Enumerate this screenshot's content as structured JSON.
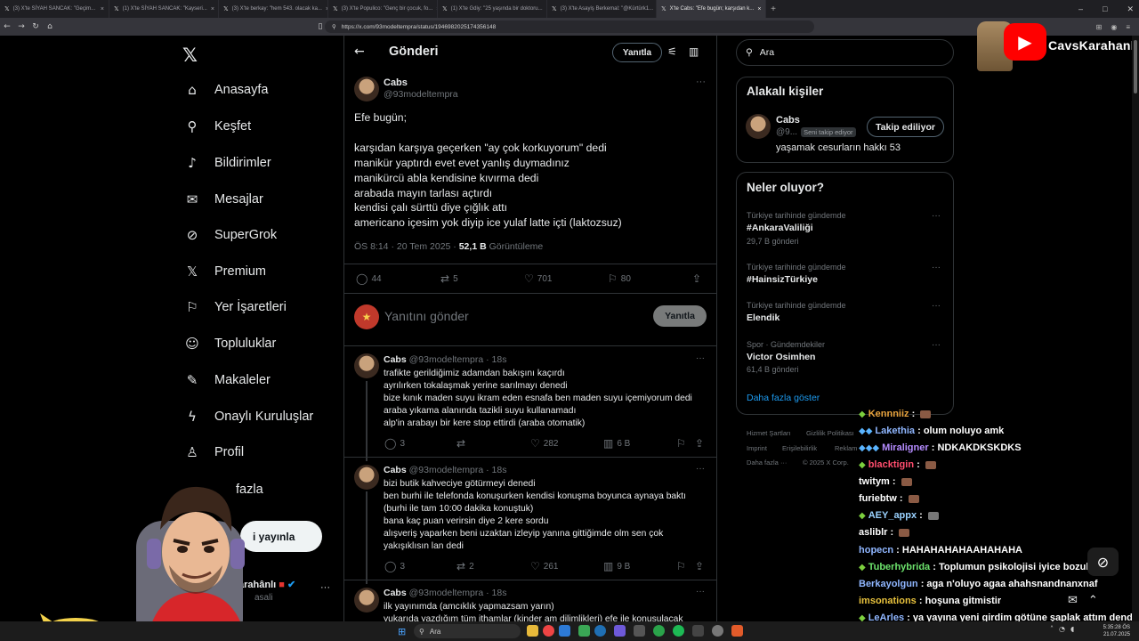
{
  "browser": {
    "tabs": [
      {
        "title": "(3) X'te SİYAH SANCAK: \"Geçim...",
        "active": false
      },
      {
        "title": "(1) X'te SİYAH SANCAK: \"Kayseri...",
        "active": false
      },
      {
        "title": "(3) X'te berkay: \"hem 543. olacak ka...",
        "active": false
      },
      {
        "title": "(3) X'te Populico: \"Genç bir çocuk, fo...",
        "active": false
      },
      {
        "title": "(1) X'te Gdiy: \"25 yaşında bir doktoru...",
        "active": false
      },
      {
        "title": "(3) X'te Asayiş Berkemal: \"@Kürtürk1...",
        "active": false
      },
      {
        "title": "X'te Cabs: \"Efe bugün; karşıdan k...",
        "active": true
      }
    ],
    "url": "https://x.com/93modeltempra/status/1946982025174356148"
  },
  "nav": {
    "items": [
      {
        "label": "Anasayfa",
        "icon": "home-icon"
      },
      {
        "label": "Keşfet",
        "icon": "search-icon"
      },
      {
        "label": "Bildirimler",
        "icon": "bell-icon"
      },
      {
        "label": "Mesajlar",
        "icon": "mail-icon"
      },
      {
        "label": "SuperGrok",
        "icon": "grok-icon"
      },
      {
        "label": "Premium",
        "icon": "x-icon"
      },
      {
        "label": "Yer İşaretleri",
        "icon": "bookmark-icon"
      },
      {
        "label": "Topluluklar",
        "icon": "people-icon"
      },
      {
        "label": "Makaleler",
        "icon": "article-icon"
      },
      {
        "label": "Onaylı Kuruluşlar",
        "icon": "lightning-icon"
      },
      {
        "label": "Profil",
        "icon": "person-icon"
      },
      {
        "label": "fazla",
        "icon": "more-icon"
      }
    ],
    "post_button": "i yayınla",
    "account_name": "arahânlı",
    "account_handle": "asali"
  },
  "header": {
    "title": "Gönderi",
    "reply_button": "Yanıtla"
  },
  "post": {
    "author": "Cabs",
    "handle": "@93modeltempra",
    "text": "Efe bugün;\n\nkarşıdan karşıya geçerken \"ay çok korkuyorum\" dedi\nmanikür yaptırdı evet evet yanlış duymadınız\nmanikürcü abla kendisine kıvırma dedi\narabada mayın tarlası açtırdı\nkendisi çalı sürttü diye çığlık attı\namericano içesim yok diyip ice yulaf latte içti (laktozsuz)",
    "time": "ÖS 8:14 · 20 Tem 2025 · ",
    "views": "52,1 B",
    "views_label": " Görüntüleme",
    "replies": "44",
    "reposts": "5",
    "likes": "701",
    "bookmarks": "80"
  },
  "composer": {
    "placeholder": "Yanıtını gönder",
    "button": "Yanıtla"
  },
  "replies": [
    {
      "author": "Cabs",
      "meta": " @93modeltempra · 18s",
      "text": "trafikte gerildiğimiz adamdan bakışını kaçırdı\nayrılırken tokalaşmak yerine sarılmayı denedi\nbize kınık maden suyu ikram eden esnafa ben maden suyu içemiyorum dedi\naraba yıkama alanında tazikli suyu kullanamadı\nalp'in arabayı bir kere stop ettirdi (araba otomatik)",
      "replies": "3",
      "reposts": "",
      "likes": "282",
      "views": "6 B"
    },
    {
      "author": "Cabs",
      "meta": " @93modeltempra · 18s",
      "text": "bizi butik kahveciye götürmeyi denedi\nben burhi ile telefonda konuşurken kendisi konuşma boyunca aynaya baktı\n(burhi ile tam 10:00 dakika konuştuk)\nbana kaç puan verirsin diye 2 kere sordu\nalışveriş yaparken beni uzaktan izleyip yanına gittiğimde olm sen çok\nyakışıklısın lan dedi",
      "replies": "3",
      "reposts": "2",
      "likes": "261",
      "views": "9 B"
    },
    {
      "author": "Cabs",
      "meta": " @93modeltempra · 18s",
      "text": "ilk yayınımda (amcıklık yapmazsam yarın)\nyukarıda yazdığım tüm ithamlar (kinder am dilimlikleri) efe ile konuşulacak",
      "replies": "",
      "reposts": "",
      "likes": "",
      "views": ""
    }
  ],
  "right": {
    "search_placeholder": "Ara",
    "who": {
      "title": "Alakalı kişiler",
      "name": "Cabs",
      "handle": "@9...",
      "badge": "Seni takip ediyor",
      "bio": "yaşamak cesurların hakkı 53",
      "button": "Takip ediliyor"
    },
    "trends": {
      "title": "Neler oluyor?",
      "items": [
        {
          "context": "Türkiye tarihinde gündemde",
          "name": "#AnkaraValiliği",
          "count": "29,7 B gönderi"
        },
        {
          "context": "Türkiye tarihinde gündemde",
          "name": "#HainsizTürkiye",
          "count": ""
        },
        {
          "context": "Türkiye tarihinde gündemde",
          "name": "Elendik",
          "count": ""
        },
        {
          "context": "Spor · Gündemdekiler",
          "name": "Victor Osimhen",
          "count": "61,4 B gönderi"
        }
      ],
      "show_more": "Daha fazla göster"
    },
    "footer": [
      "Hizmet Şartları",
      "Gizlilik Politikası",
      "Imprint",
      "Erişilebilirlik",
      "Reklam",
      "Daha fazla ···",
      "© 2025 X Corp."
    ]
  },
  "stream": {
    "channel": "CavsKarahanli",
    "chat": [
      {
        "user": "Kennniiz",
        "color": "#e8a33d",
        "msg": ""
      },
      {
        "user": "Lakethia",
        "color": "#8fb6ff",
        "msg": "olum noluyo amk"
      },
      {
        "user": "Miraligner",
        "color": "#b58cff",
        "msg": "NDKAKDKSKDKS"
      },
      {
        "user": "blacktigin",
        "color": "#ff4d6d",
        "msg": ""
      },
      {
        "user": "twitym",
        "color": "#ffffff",
        "msg": ""
      },
      {
        "user": "furiebtw",
        "color": "#ffffff",
        "msg": ""
      },
      {
        "user": "AEY_appx",
        "color": "#9ad2ff",
        "msg": ""
      },
      {
        "user": "asliblr",
        "color": "#ffffff",
        "msg": ""
      },
      {
        "user": "hopecn",
        "color": "#8fb6ff",
        "msg": "HAHAHAHAHAAHAHAHA"
      },
      {
        "user": "Tuberhybrida",
        "color": "#6de36d",
        "msg": "Toplumun psikolojisi iyice bozulmuş"
      },
      {
        "user": "Berkayolgun",
        "color": "#8fb6ff",
        "msg": "aga n'oluyo agaa ahahsnandnanxnaf"
      },
      {
        "user": "imsonations",
        "color": "#e8c23d",
        "msg": "hoşuna gitmistir"
      },
      {
        "user": "LeArles",
        "color": "#8fb6ff",
        "msg": "ya yayına yeni girdim götüne şaplak attım dendi"
      }
    ]
  },
  "taskbar": {
    "search": "Ara",
    "time": "5:35:28 ÖS",
    "date": "21.07.2025"
  }
}
